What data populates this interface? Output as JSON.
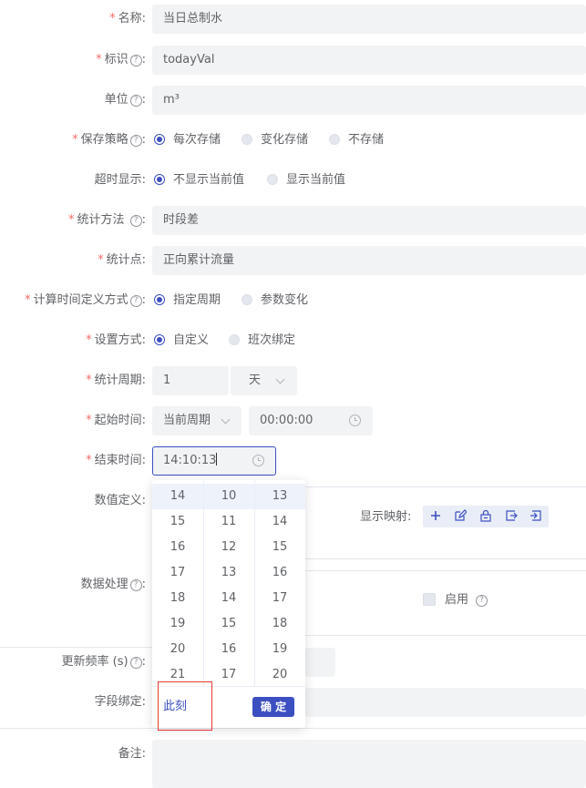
{
  "form": {
    "name": {
      "label": "名称:",
      "value": "当日总制水"
    },
    "identifier": {
      "label": "标识",
      "value": "todayVal"
    },
    "unit": {
      "label": "单位",
      "value": "m³"
    },
    "save_strategy": {
      "label": "保存策略",
      "options": [
        "每次存储",
        "变化存储",
        "不存储"
      ],
      "selected": 0
    },
    "timeout_display": {
      "label": "超时显示:",
      "options": [
        "不显示当前值",
        "显示当前值"
      ],
      "selected": 0
    },
    "stat_method": {
      "label": "统计方法",
      "value": "时段差"
    },
    "stat_point": {
      "label": "统计点:",
      "value": "正向累计流量"
    },
    "calc_time_def": {
      "label": "计算时间定义方式",
      "options": [
        "指定周期",
        "参数变化"
      ],
      "selected": 0
    },
    "set_mode": {
      "label": "设置方式:",
      "options": [
        "自定义",
        "班次绑定"
      ],
      "selected": 0
    },
    "stat_period": {
      "label": "统计周期:",
      "value": "1",
      "unit": "天"
    },
    "start_time": {
      "label": "起始时间:",
      "period": "当前周期",
      "time": "00:00:00"
    },
    "end_time": {
      "label": "结束时间:",
      "value": "14:10:13"
    },
    "value_def": {
      "label": "数值定义:",
      "display_map_label": "显示映射:"
    },
    "data_process": {
      "label": "数据处理",
      "enable_label": "启用"
    },
    "update_freq": {
      "label": "更新频率 (s)"
    },
    "field_binding": {
      "label": "字段绑定:"
    },
    "remark": {
      "label": "备注:"
    }
  },
  "required_mark": "*",
  "help_glyph": "?",
  "colon": ":",
  "toolbar_icons": [
    "plus-icon",
    "edit-icon",
    "lock-icon",
    "export-icon",
    "import-icon"
  ],
  "time_picker": {
    "hours": [
      "14",
      "15",
      "16",
      "17",
      "18",
      "19",
      "20",
      "21"
    ],
    "minutes": [
      "10",
      "11",
      "12",
      "13",
      "14",
      "15",
      "16",
      "17"
    ],
    "seconds": [
      "13",
      "14",
      "15",
      "16",
      "17",
      "18",
      "19",
      "20"
    ],
    "now_label": "此刻",
    "confirm_label": "确 定"
  },
  "colors": {
    "primary": "#3c4fc1",
    "required": "#f56c6c",
    "field_bg": "#f2f3f5"
  }
}
